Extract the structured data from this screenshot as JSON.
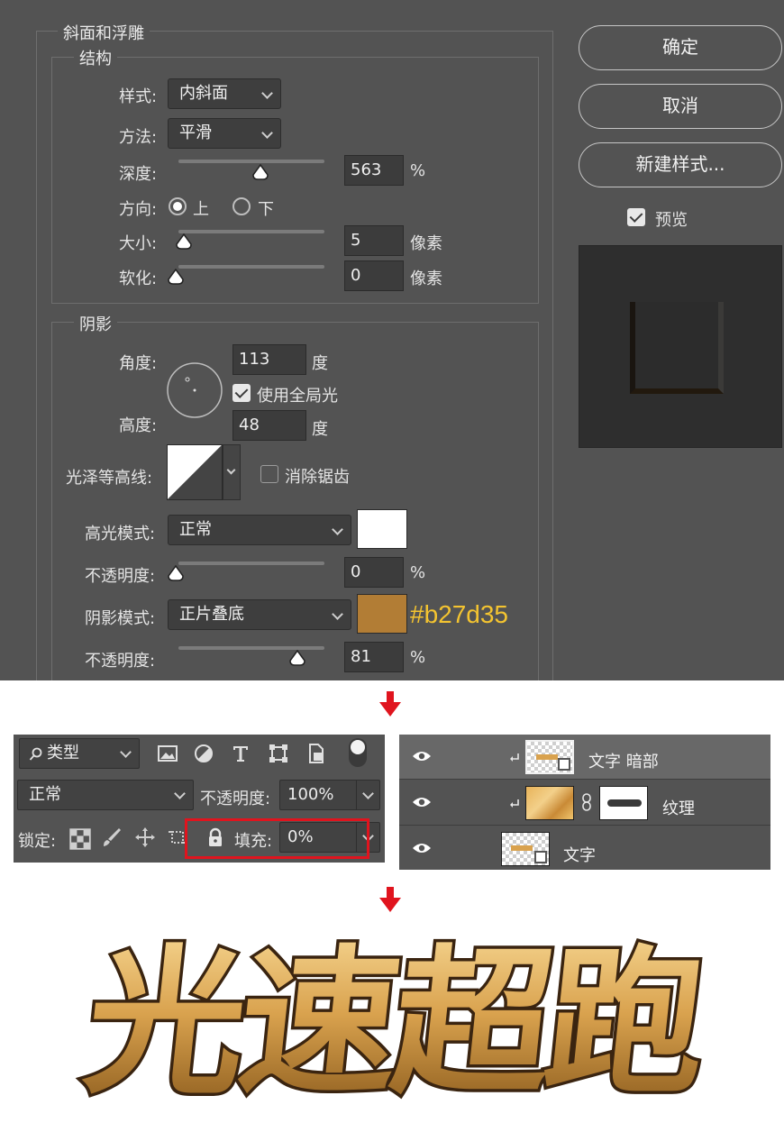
{
  "dialog": {
    "section_title": "斜面和浮雕",
    "structure": {
      "title": "结构",
      "style_label": "样式:",
      "style_value": "内斜面",
      "technique_label": "方法:",
      "technique_value": "平滑",
      "depth_label": "深度:",
      "depth_value": "563",
      "depth_unit": "%",
      "depth_level": 0.56,
      "direction_label": "方向:",
      "direction_up": "上",
      "direction_down": "下",
      "direction_selected": "上",
      "size_label": "大小:",
      "size_value": "5",
      "size_unit": "像素",
      "soften_label": "软化:",
      "soften_value": "0",
      "soften_unit": "像素"
    },
    "shading": {
      "title": "阴影",
      "angle_label": "角度:",
      "angle_value": "113",
      "angle_unit": "度",
      "global_light_label": "使用全局光",
      "global_light_checked": true,
      "altitude_label": "高度:",
      "altitude_value": "48",
      "altitude_unit": "度",
      "gloss_contour_label": "光泽等高线:",
      "anti_aliased_label": "消除锯齿",
      "anti_aliased_checked": false,
      "highlight_mode_label": "高光模式:",
      "highlight_mode_value": "正常",
      "highlight_color": "#ffffff",
      "highlight_opacity_label": "不透明度:",
      "highlight_opacity_value": "0",
      "highlight_opacity_unit": "%",
      "shadow_mode_label": "阴影模式:",
      "shadow_mode_value": "正片叠底",
      "shadow_color": "#b27d35",
      "shadow_color_annotation": "#b27d35",
      "shadow_opacity_label": "不透明度:",
      "shadow_opacity_value": "81",
      "shadow_opacity_unit": "%",
      "shadow_opacity_level": 0.81
    },
    "buttons": {
      "ok": "确定",
      "cancel": "取消",
      "new_style": "新建样式..."
    },
    "preview_label": "预览",
    "preview_checked": true
  },
  "layers_toolbar": {
    "filter_label": "类型",
    "blend_mode": "正常",
    "opacity_label": "不透明度:",
    "opacity_value": "100%",
    "lock_label": "锁定:",
    "fill_label": "填充:",
    "fill_value": "0%"
  },
  "layers": [
    {
      "name": "文字 暗部",
      "clipped": true,
      "selected": true
    },
    {
      "name": "纹理",
      "clipped": true,
      "selected": false
    },
    {
      "name": "文字",
      "clipped": false,
      "selected": false
    }
  ],
  "artwork": {
    "text": "光速超跑",
    "colors": {
      "gold": "#d9a24e",
      "gold_light": "#f3d08a",
      "gold_dark": "#8a5a1c",
      "outline": "#3a2410"
    }
  },
  "accent": {
    "arrow": "#e0141e",
    "highlight_box": "#e0141e"
  }
}
